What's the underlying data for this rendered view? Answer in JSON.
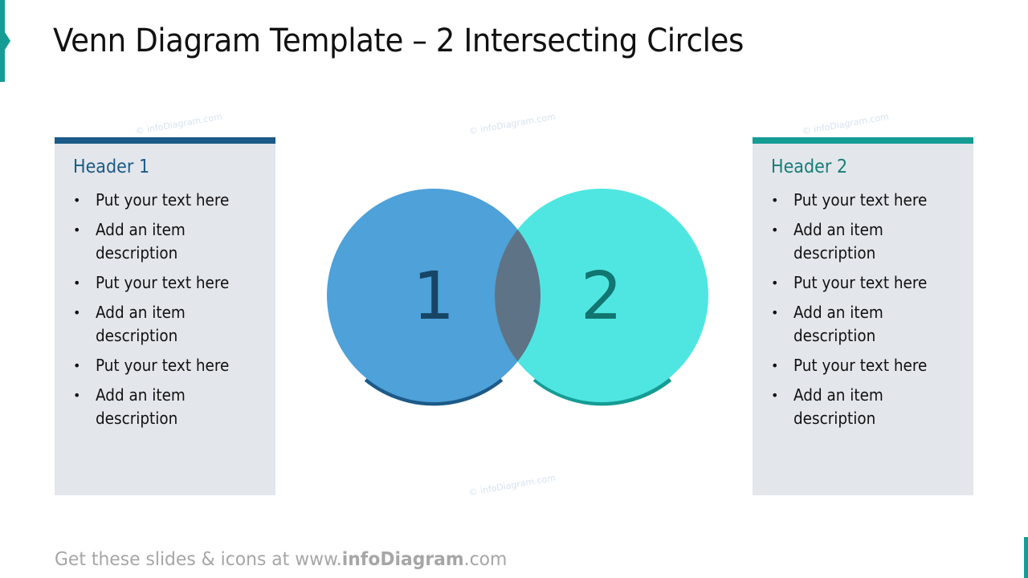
{
  "slide": {
    "title": "Venn Diagram Template – 2 Intersecting Circles",
    "watermark": "© infoDiagram.com",
    "colors": {
      "accent_teal": "#159c94",
      "circle1_fill": "#4ea1d9",
      "circle2_fill": "#4fe6e1",
      "intersection_fill": "#5e7386",
      "circle1_arc": "#1c5a87",
      "circle2_arc": "#159c94",
      "label1_color": "#174566",
      "label2_color": "#117570",
      "panel_bg": "#e3e6eb"
    }
  },
  "panels": [
    {
      "header": "Header 1",
      "items": [
        "Put your text here",
        "Add an item description",
        "Put your text here",
        "Add an item description",
        "Put your text here",
        "Add an item description"
      ]
    },
    {
      "header": "Header 2",
      "items": [
        "Put your text here",
        "Add an item description",
        "Put your text here",
        "Add an item description",
        "Put your text here",
        "Add an item description"
      ]
    }
  ],
  "venn": {
    "circle1_label": "1",
    "circle2_label": "2"
  },
  "footer": {
    "prefix": "Get these slides & icons at www.",
    "brand": "infoDiagram",
    "suffix": ".com"
  },
  "bullet_glyph": "•"
}
